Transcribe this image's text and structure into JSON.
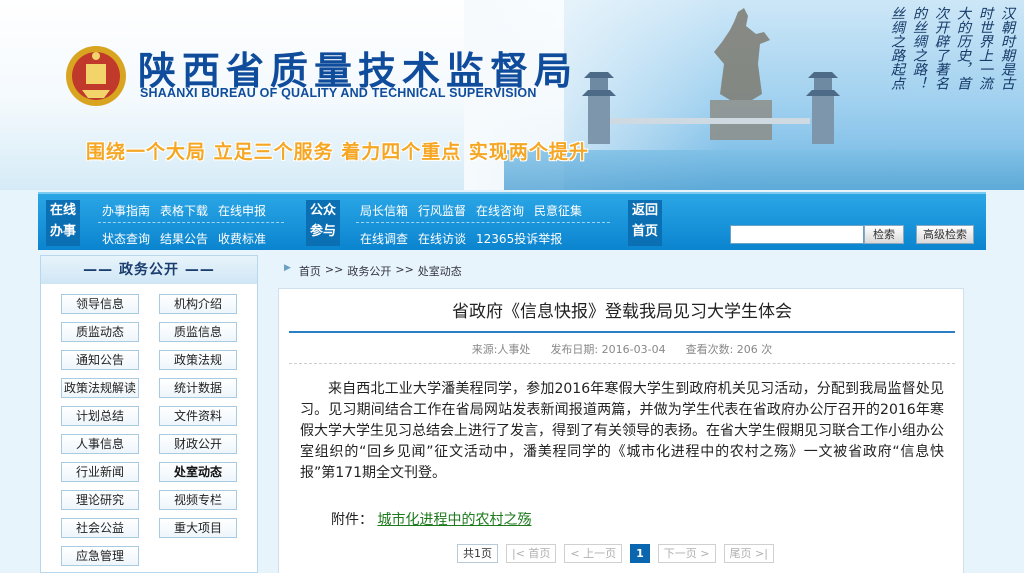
{
  "header": {
    "title_cn": "陕西省质量技术监督局",
    "title_en": "SHAANXI BUREAU OF QUALITY AND TECHNICAL SUPERVISION",
    "slogan": "围绕一个大局 立足三个服务 着力四个重点 实现两个提升",
    "poem_columns": [
      "汉朝时期是古",
      "丝绸之路起点",
      "时世界上一流",
      "大的历史，首",
      "次开辟了著名",
      "的丝绸之路！"
    ]
  },
  "nav": {
    "block1": [
      "在线",
      "办事"
    ],
    "row1_group1": [
      "办事指南",
      "表格下载",
      "在线申报"
    ],
    "row2_group1": [
      "状态查询",
      "结果公告",
      "收费标准"
    ],
    "block2": [
      "公众",
      "参与"
    ],
    "row1_group2": [
      "局长信箱",
      "行风监督",
      "在线咨询",
      "民意征集"
    ],
    "row2_group2": [
      "在线调查",
      "在线访谈",
      "12365投诉举报"
    ],
    "block3": [
      "返回",
      "首页"
    ],
    "search_value": "",
    "search_button": "检索",
    "advanced_button": "高级检索"
  },
  "sidebar": {
    "title": "—— 政务公开 ——",
    "items": [
      "领导信息",
      "机构介绍",
      "质监动态",
      "质监信息",
      "通知公告",
      "政策法规",
      "政策法规解读",
      "统计数据",
      "计划总结",
      "文件资料",
      "人事信息",
      "财政公开",
      "行业新闻",
      "处室动态",
      "理论研究",
      "视频专栏",
      "社会公益",
      "重大项目",
      "应急管理"
    ],
    "active_item": "处室动态"
  },
  "breadcrumb": [
    "首页",
    ">>",
    "政务公开",
    ">>",
    "处室动态"
  ],
  "article": {
    "title": "省政府《信息快报》登载我局见习大学生体会",
    "source": "来源:人事处",
    "date": "发布日期: 2016-03-04",
    "views": "查看次数: 206 次",
    "body": "来自西北工业大学潘美程同学，参加2016年寒假大学生到政府机关见习活动，分配到我局监督处见习。见习期间结合工作在省局网站发表新闻报道两篇，并做为学生代表在省政府办公厅召开的2016年寒假大学大学生见习总结会上进行了发言，得到了有关领导的表扬。在省大学生假期见习联合工作小组办公室组织的“回乡见闻”征文活动中，潘美程同学的《城市化进程中的农村之殇》一文被省政府“信息快报”第171期全文刊登。",
    "attachment_label": "附件：",
    "attachment_link": "城市化进程中的农村之殇"
  },
  "pager": {
    "total": "共1页",
    "first": "|< 首页",
    "prev": "< 上一页",
    "current": "1",
    "next": "下一页 >",
    "last": "尾页 >|"
  },
  "colors": {
    "brand_blue": "#0f4c9c",
    "nav_blue": "#1596db",
    "slogan_orange": "#f5a623",
    "link_green": "#1d7a1d"
  }
}
